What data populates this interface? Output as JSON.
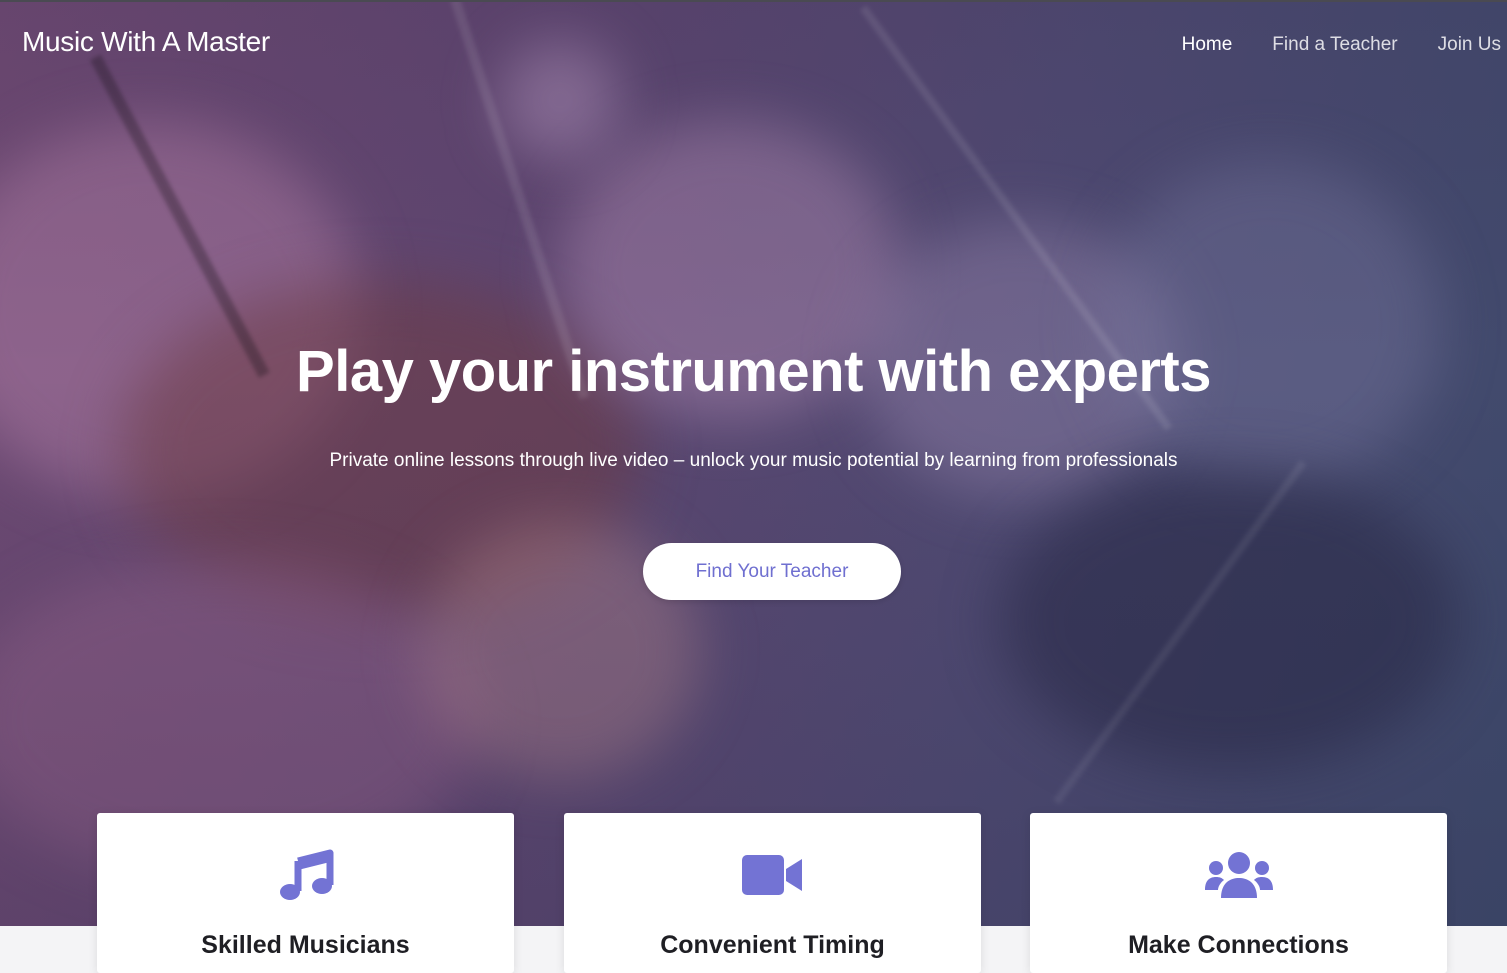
{
  "site": {
    "brand": "Music With A Master"
  },
  "nav": {
    "items": [
      {
        "label": "Home",
        "active": true
      },
      {
        "label": "Find a Teacher",
        "active": false
      },
      {
        "label": "Join Us",
        "active": false
      }
    ]
  },
  "hero": {
    "title": "Play your instrument with experts",
    "subtitle": "Private online lessons through live video – unlock your music potential by learning from professionals",
    "cta_label": "Find Your Teacher"
  },
  "features": [
    {
      "title": "Skilled Musicians",
      "icon": "music-note-icon"
    },
    {
      "title": "Convenient Timing",
      "icon": "video-camera-icon"
    },
    {
      "title": "Make Connections",
      "icon": "users-group-icon"
    }
  ],
  "colors": {
    "accent": "#7373d4",
    "hero_overlay": "#5e4670",
    "cta_text": "#6f6fd0",
    "card_bg": "#ffffff",
    "card_title": "#1f1f24"
  }
}
